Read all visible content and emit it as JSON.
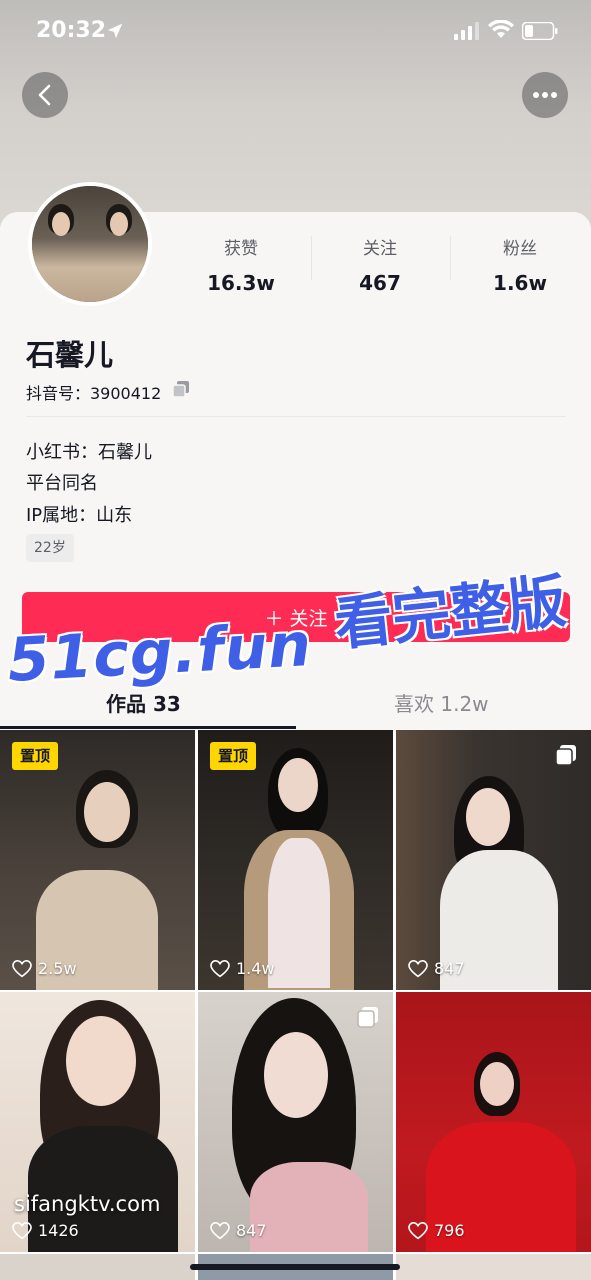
{
  "status_bar": {
    "time": "20:32"
  },
  "profile": {
    "name": "石馨儿",
    "douyin_id": "抖音号：3900412",
    "stats": [
      {
        "label": "获赞",
        "value": "16.3w"
      },
      {
        "label": "关注",
        "value": "467"
      },
      {
        "label": "粉丝",
        "value": "1.6w"
      }
    ],
    "bio_lines": [
      "小红书：石馨儿",
      "平台同名",
      "IP属地：山东"
    ],
    "age_tag": "22岁",
    "follow_label": "＋ 关注"
  },
  "watermark": {
    "site": "51cg.fun",
    "slogan": "看完整版",
    "corner": "sifangktv.com"
  },
  "tabs": [
    {
      "label": "作品 33",
      "active": true
    },
    {
      "label": "喜欢 1.2w",
      "active": false
    }
  ],
  "posts": [
    {
      "pinned": true,
      "pin_label": "置顶",
      "likes": "2.5w",
      "multi": false,
      "bg": "#3b3530",
      "accent": "#d8c8b4"
    },
    {
      "pinned": true,
      "pin_label": "置顶",
      "likes": "1.4w",
      "multi": false,
      "bg": "#2a2623",
      "accent": "#f0e8e8"
    },
    {
      "pinned": false,
      "likes": "847",
      "multi": true,
      "bg": "#3d3834",
      "accent": "#e9e6e2"
    },
    {
      "pinned": false,
      "likes": "1426",
      "multi": false,
      "bg": "#e8dcd3",
      "accent": "#1f1c1a"
    },
    {
      "pinned": false,
      "likes": "847",
      "multi": true,
      "bg": "#cfc8c2",
      "accent": "#e8b9bf"
    },
    {
      "pinned": false,
      "likes": "796",
      "multi": false,
      "bg": "#b5161c",
      "accent": "#d8161e"
    }
  ],
  "colors": {
    "accent": "#fe2c55",
    "pin": "#ffd600",
    "watermark": "#3e5fe6"
  }
}
